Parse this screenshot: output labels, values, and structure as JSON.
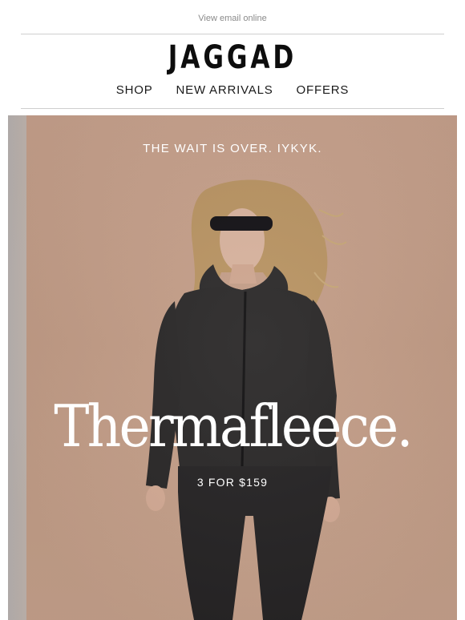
{
  "header": {
    "view_online": "View email online",
    "logo": "JAGGAD"
  },
  "nav": {
    "items": [
      "SHOP",
      "NEW ARRIVALS",
      "OFFERS"
    ]
  },
  "hero": {
    "eyebrow": "THE WAIT IS OVER. IYKYK.",
    "headline": "Thermafleece.",
    "offer": "3 FOR $159",
    "image": "woman-wearing-black-fleece-jacket-sunglasses-leggings",
    "colors": {
      "background": "#c5a08a",
      "garment": "#2a2828",
      "text": "#ffffff"
    }
  }
}
